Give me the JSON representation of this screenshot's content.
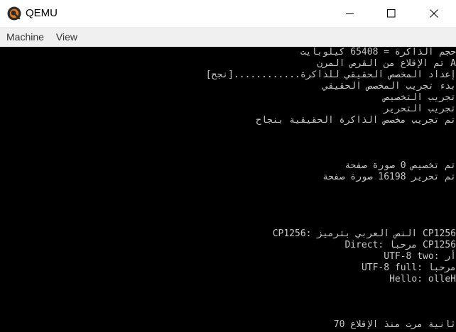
{
  "window": {
    "title": "QEMU",
    "icon": "qemu-logo-icon",
    "controls": {
      "minimize": "minimize-icon",
      "maximize": "maximize-icon",
      "close": "close-icon"
    }
  },
  "menubar": {
    "items": [
      {
        "label": "Machine"
      },
      {
        "label": "View"
      }
    ]
  },
  "console": {
    "lines": [
      "حجم الذاكرة = 65408 كيلوبايت",
      "تم الإقلاع من القرص المرن A",
      "إعداد المخصص الحقيقي للذاكرة............[نجح]",
      "بدء تجريب المخصص الحقيقي",
      "تجريب التخصيص",
      "تجريب التحرير",
      "تم تجريب مخصص الذاكرة الحقيقية بنجاح",
      "",
      "",
      "",
      "تم تخصيص 0 صورة صفحة",
      "تم تحرير 16198 صورة صفحة",
      "",
      "",
      "",
      "",
      "CP1256: النص العربي بترميز CP1256",
      "Direct: مرحبا CP1256",
      "UTF-8 two: أر",
      "UTF-8 full: مرحبا",
      "Hello: olleH",
      "",
      "",
      "",
      "70 ثانية مرت منذ الإقلاع"
    ]
  }
}
